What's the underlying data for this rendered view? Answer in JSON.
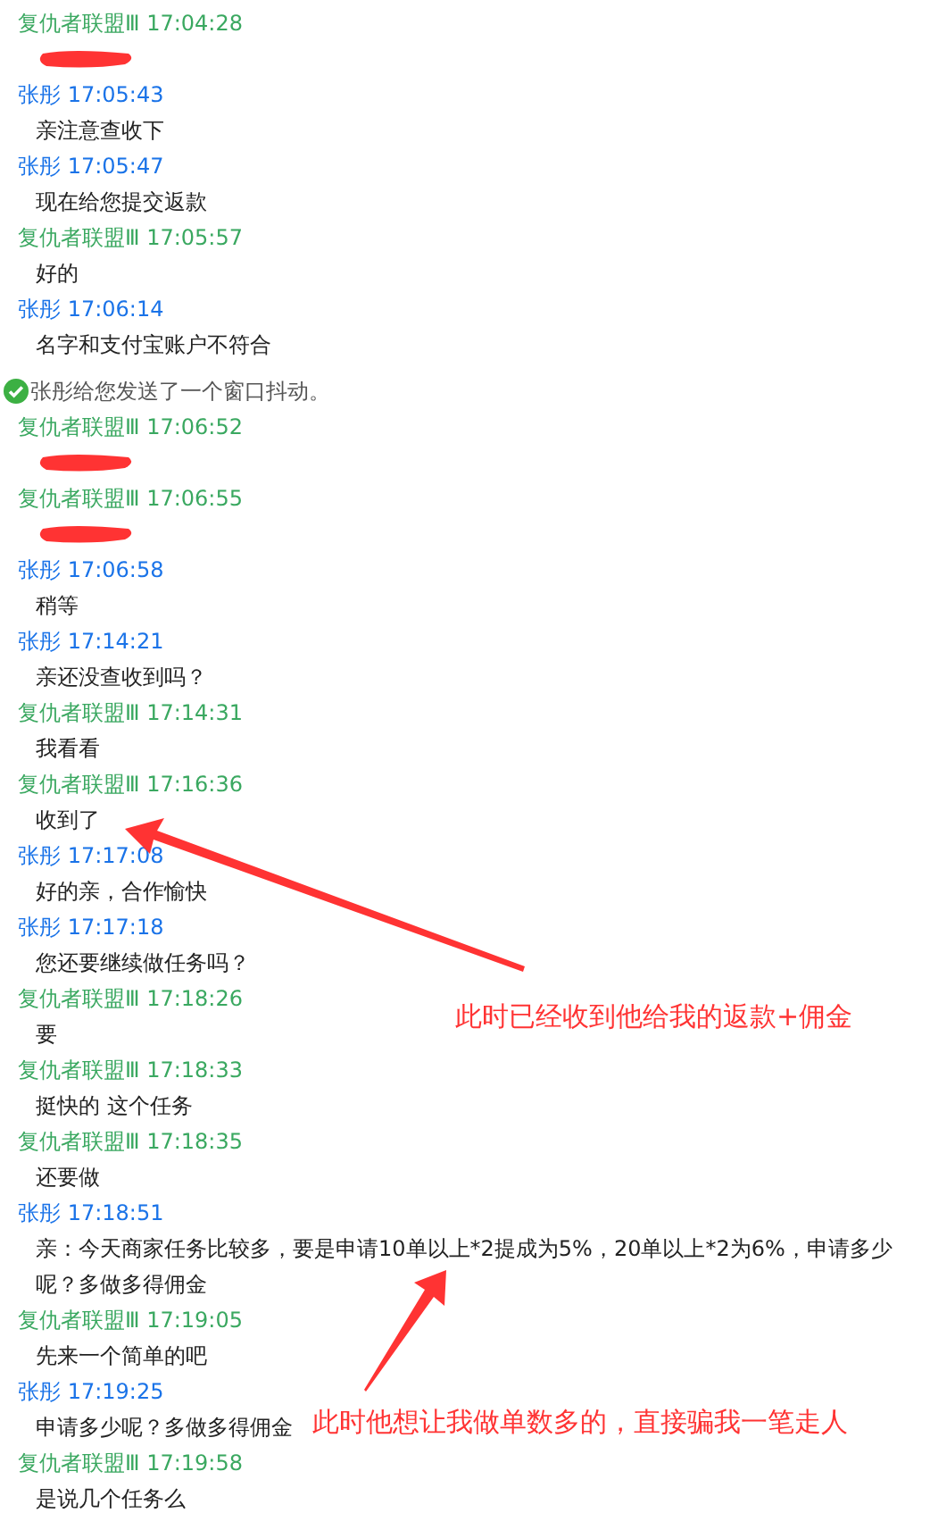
{
  "messages": [
    {
      "kind": "redacted",
      "sender": "复仇者联盟Ⅲ",
      "time": "17:04:28",
      "color": "#3aa860"
    },
    {
      "kind": "text",
      "sender": "张彤",
      "time": "17:05:43",
      "color": "#1a73e8",
      "text": "亲注意查收下"
    },
    {
      "kind": "text",
      "sender": "张彤",
      "time": "17:05:47",
      "color": "#1a73e8",
      "text": "现在给您提交返款"
    },
    {
      "kind": "text",
      "sender": "复仇者联盟Ⅲ",
      "time": "17:05:57",
      "color": "#3aa860",
      "text": "好的"
    },
    {
      "kind": "text",
      "sender": "张彤",
      "time": "17:06:14",
      "color": "#1a73e8",
      "text": "名字和支付宝账户不符合"
    },
    {
      "kind": "system",
      "text": "张彤给您发送了一个窗口抖动。"
    },
    {
      "kind": "redacted",
      "sender": "复仇者联盟Ⅲ",
      "time": "17:06:52",
      "color": "#3aa860"
    },
    {
      "kind": "redacted",
      "sender": "复仇者联盟Ⅲ",
      "time": "17:06:55",
      "color": "#3aa860"
    },
    {
      "kind": "text",
      "sender": "张彤",
      "time": "17:06:58",
      "color": "#1a73e8",
      "text": "稍等"
    },
    {
      "kind": "text",
      "sender": "张彤",
      "time": "17:14:21",
      "color": "#1a73e8",
      "text": "亲还没查收到吗？"
    },
    {
      "kind": "text",
      "sender": "复仇者联盟Ⅲ",
      "time": "17:14:31",
      "color": "#3aa860",
      "text": "我看看"
    },
    {
      "kind": "text",
      "sender": "复仇者联盟Ⅲ",
      "time": "17:16:36",
      "color": "#3aa860",
      "text": "收到了"
    },
    {
      "kind": "text",
      "sender": "张彤",
      "time": "17:17:08",
      "color": "#1a73e8",
      "text": "好的亲，合作愉快"
    },
    {
      "kind": "text",
      "sender": "张彤",
      "time": "17:17:18",
      "color": "#1a73e8",
      "text": "您还要继续做任务吗？"
    },
    {
      "kind": "text",
      "sender": "复仇者联盟Ⅲ",
      "time": "17:18:26",
      "color": "#3aa860",
      "text": "要"
    },
    {
      "kind": "text",
      "sender": "复仇者联盟Ⅲ",
      "time": "17:18:33",
      "color": "#3aa860",
      "text": "挺快的 这个任务"
    },
    {
      "kind": "text",
      "sender": "复仇者联盟Ⅲ",
      "time": "17:18:35",
      "color": "#3aa860",
      "text": "还要做"
    },
    {
      "kind": "text",
      "sender": "张彤",
      "time": "17:18:51",
      "color": "#1a73e8",
      "text": "亲：今天商家任务比较多，要是申请10单以上*2提成为5%，20单以上*2为6%，申请多少呢？多做多得佣金"
    },
    {
      "kind": "text",
      "sender": "复仇者联盟Ⅲ",
      "time": "17:19:05",
      "color": "#3aa860",
      "text": "先来一个简单的吧"
    },
    {
      "kind": "text",
      "sender": "张彤",
      "time": "17:19:25",
      "color": "#1a73e8",
      "text": "申请多少呢？多做多得佣金"
    },
    {
      "kind": "text",
      "sender": "复仇者联盟Ⅲ",
      "time": "17:19:58",
      "color": "#3aa860",
      "text": "是说几个任务么"
    }
  ],
  "annotations": [
    {
      "text": "此时已经收到他给我的返款+佣金"
    },
    {
      "text": "此时他想让我做单数多的，直接骗我一笔走人"
    }
  ]
}
